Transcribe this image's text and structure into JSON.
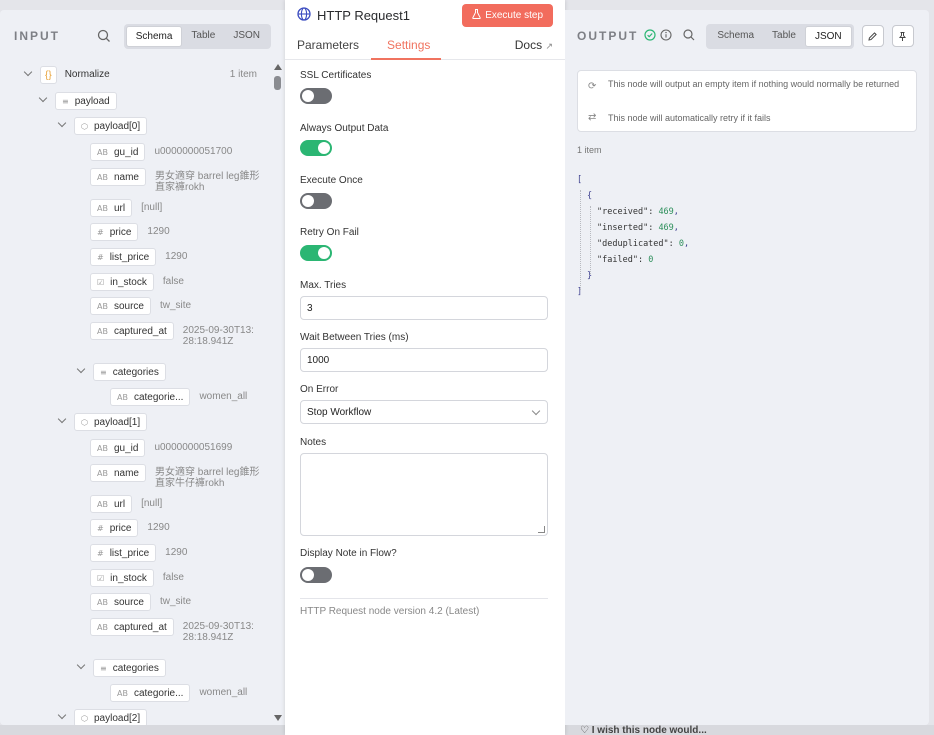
{
  "input": {
    "title": "INPUT",
    "view_tabs": [
      "Schema",
      "Table",
      "JSON"
    ],
    "active_tab": "Schema",
    "root": {
      "label": "Normalize",
      "meta": "1 item"
    },
    "payload_label": "payload",
    "items": [
      {
        "label": "payload[0]",
        "fields": [
          {
            "name": "gu_id",
            "type": "AB",
            "value": "u0000000051700"
          },
          {
            "name": "name",
            "type": "AB",
            "value": "男女適穿 barrel leg錐形 直家褲rokh"
          },
          {
            "name": "url",
            "type": "AB",
            "value": "[null]"
          },
          {
            "name": "price",
            "type": "#",
            "value": "1290"
          },
          {
            "name": "list_price",
            "type": "#",
            "value": "1290"
          },
          {
            "name": "in_stock",
            "type": "☑",
            "value": "false"
          },
          {
            "name": "source",
            "type": "AB",
            "value": "tw_site"
          },
          {
            "name": "captured_at",
            "type": "AB",
            "value": "2025-09-30T13:28:18.941Z"
          }
        ],
        "categories": {
          "label": "categories",
          "child": "categorie...",
          "value": "women_all"
        }
      },
      {
        "label": "payload[1]",
        "fields": [
          {
            "name": "gu_id",
            "type": "AB",
            "value": "u0000000051699"
          },
          {
            "name": "name",
            "type": "AB",
            "value": "男女適穿 barrel leg錐形 直家牛仔褲rokh"
          },
          {
            "name": "url",
            "type": "AB",
            "value": "[null]"
          },
          {
            "name": "price",
            "type": "#",
            "value": "1290"
          },
          {
            "name": "list_price",
            "type": "#",
            "value": "1290"
          },
          {
            "name": "in_stock",
            "type": "☑",
            "value": "false"
          },
          {
            "name": "source",
            "type": "AB",
            "value": "tw_site"
          },
          {
            "name": "captured_at",
            "type": "AB",
            "value": "2025-09-30T13:28:18.941Z"
          }
        ],
        "categories": {
          "label": "categories",
          "child": "categorie...",
          "value": "women_all"
        }
      },
      {
        "label": "payload[2]"
      }
    ]
  },
  "node": {
    "title": "HTTP Request1",
    "execute_label": "Execute step",
    "tabs": [
      "Parameters",
      "Settings"
    ],
    "active_tab": "Settings",
    "docs_label": "Docs",
    "settings": {
      "ssl_label": "SSL Certificates",
      "ssl_on": false,
      "always_output_label": "Always Output Data",
      "always_output_on": true,
      "execute_once_label": "Execute Once",
      "execute_once_on": false,
      "retry_label": "Retry On Fail",
      "retry_on": true,
      "max_tries_label": "Max. Tries",
      "max_tries_value": "3",
      "wait_label": "Wait Between Tries (ms)",
      "wait_value": "1000",
      "on_error_label": "On Error",
      "on_error_value": "Stop Workflow",
      "notes_label": "Notes",
      "notes_value": "",
      "display_note_label": "Display Note in Flow?",
      "display_note_on": false
    },
    "version_text": "HTTP Request node version 4.2 (Latest)"
  },
  "output": {
    "title": "OUTPUT",
    "view_tabs": [
      "Schema",
      "Table",
      "JSON"
    ],
    "active_tab": "JSON",
    "notices": [
      "This node will output an empty item if nothing would normally be returned",
      "This node will automatically retry if it fails"
    ],
    "item_count": "1 item",
    "json": [
      {
        "key": "received",
        "value": "469"
      },
      {
        "key": "inserted",
        "value": "469"
      },
      {
        "key": "deduplicated",
        "value": "0"
      },
      {
        "key": "failed",
        "value": "0"
      }
    ]
  },
  "canvas_hint": "I wish this node would..."
}
